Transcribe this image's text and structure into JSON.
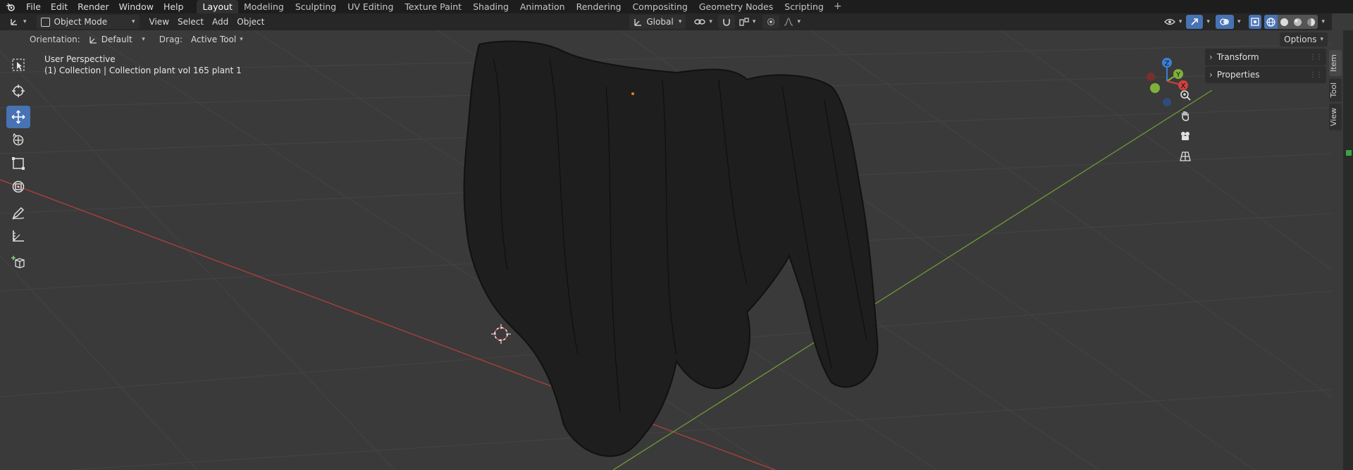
{
  "menu": {
    "items": [
      "File",
      "Edit",
      "Render",
      "Window",
      "Help"
    ]
  },
  "workspace_tabs": [
    {
      "label": "Layout",
      "active": true
    },
    {
      "label": "Modeling",
      "active": false
    },
    {
      "label": "Sculpting",
      "active": false
    },
    {
      "label": "UV Editing",
      "active": false
    },
    {
      "label": "Texture Paint",
      "active": false
    },
    {
      "label": "Shading",
      "active": false
    },
    {
      "label": "Animation",
      "active": false
    },
    {
      "label": "Rendering",
      "active": false
    },
    {
      "label": "Compositing",
      "active": false
    },
    {
      "label": "Geometry Nodes",
      "active": false
    },
    {
      "label": "Scripting",
      "active": false
    }
  ],
  "tab_add_symbol": "+",
  "header": {
    "mode": "Object Mode",
    "view": "View",
    "select": "Select",
    "add": "Add",
    "object": "Object",
    "transform_orientation": "Global"
  },
  "tool_settings": {
    "orientation_label": "Orientation:",
    "orientation_value": "Default",
    "drag_label": "Drag:",
    "drag_value": "Active Tool",
    "options": "Options"
  },
  "viewport": {
    "perspective": "User Perspective",
    "collection": "(1) Collection | Collection plant vol 165 plant 1"
  },
  "gizmo_axes": {
    "x": "X",
    "y": "Y",
    "z": "Z"
  },
  "npanel": {
    "sections": [
      "Transform",
      "Properties"
    ]
  },
  "sidetabs": [
    "Item",
    "Tool",
    "View"
  ],
  "colors": {
    "accent": "#4772b3",
    "axis_x": "#d0413d",
    "axis_y": "#7fb03a",
    "axis_z": "#3d7ed6",
    "viewport_bg": "#3a3a3a"
  },
  "icons": {
    "tools": [
      "select-box-icon",
      "cursor-icon",
      "move-icon",
      "rotate-icon",
      "scale-icon",
      "transform-icon",
      "annotate-icon",
      "measure-icon",
      "add-cube-icon"
    ],
    "nav": [
      "zoom-icon",
      "hand-pan-icon",
      "camera-icon",
      "grid-view-icon"
    ]
  }
}
